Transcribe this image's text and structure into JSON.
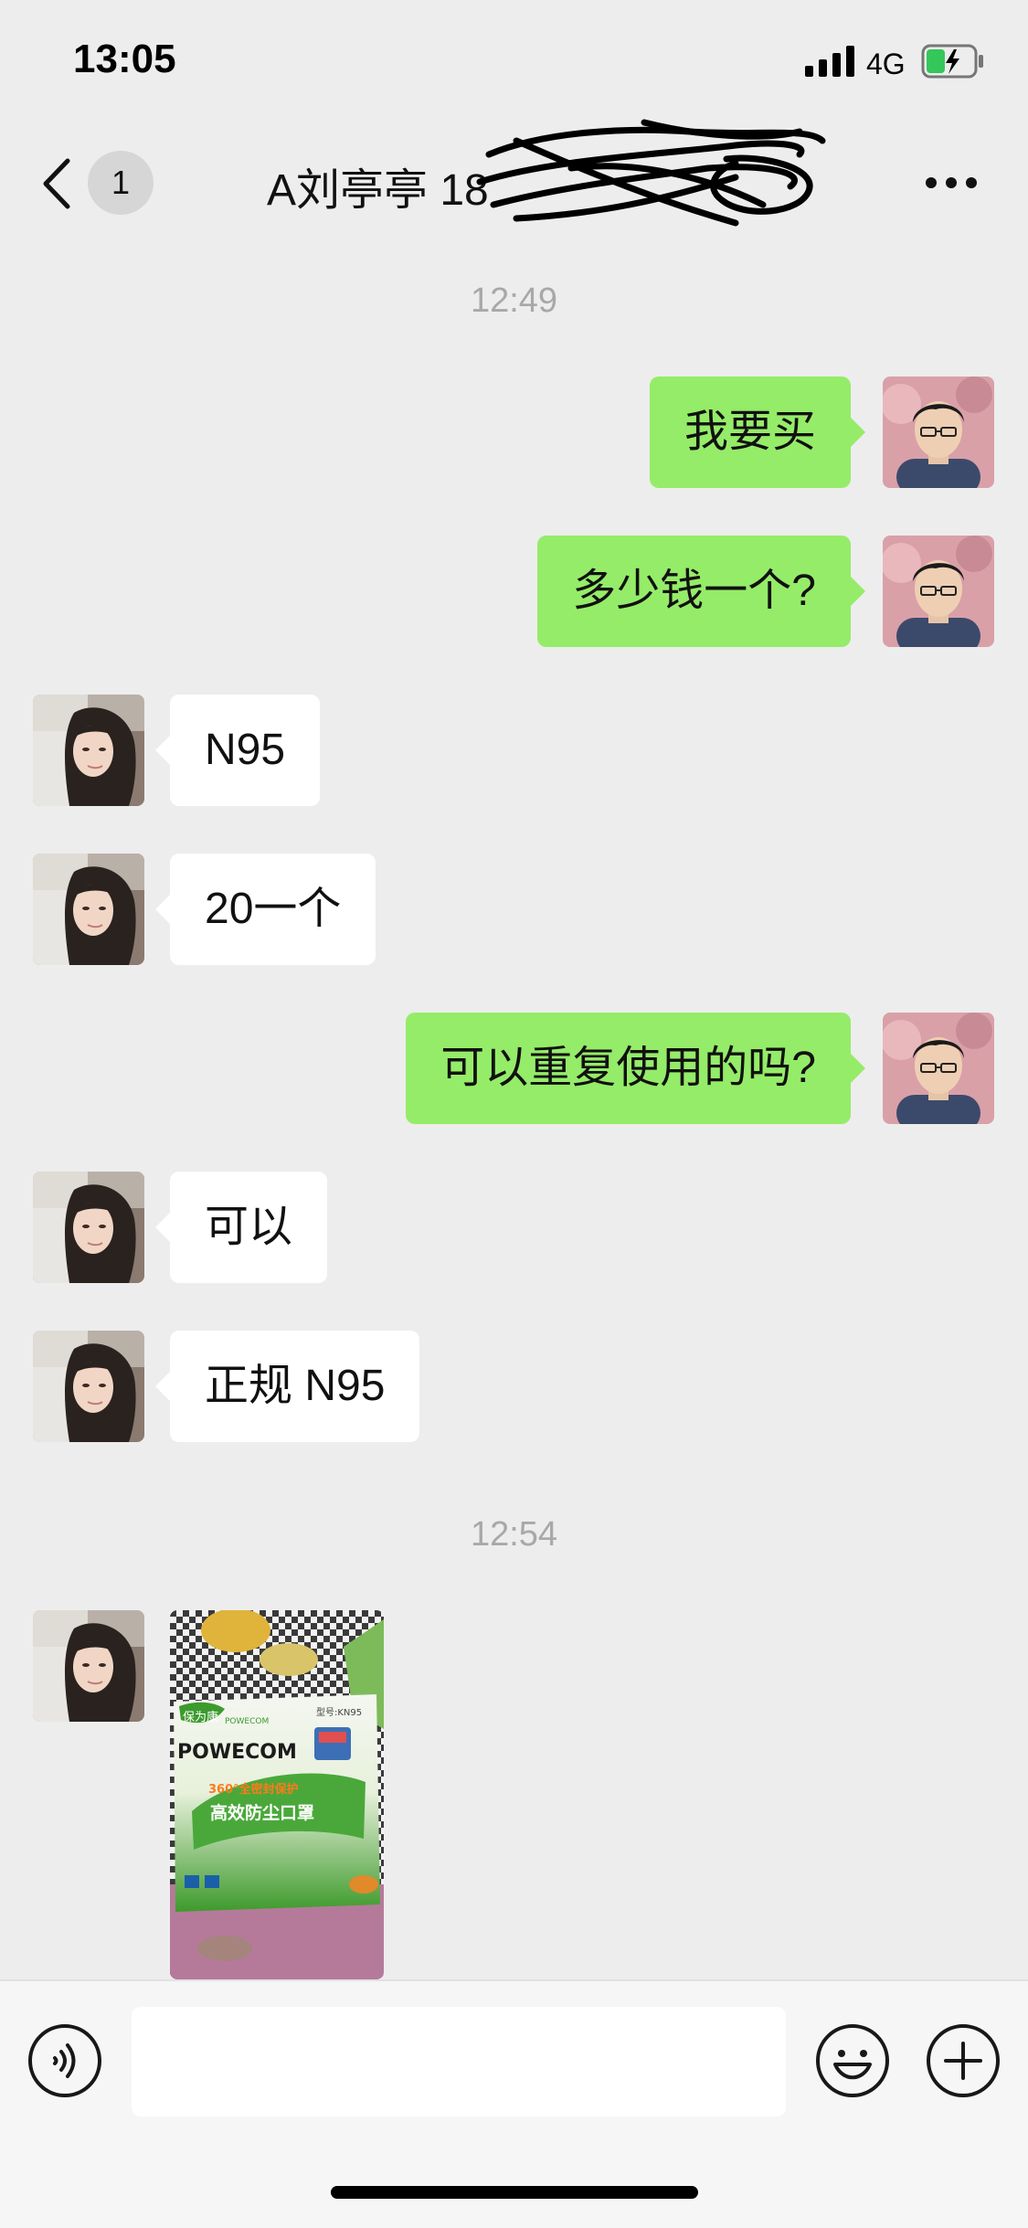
{
  "status_bar": {
    "time": "13:05",
    "network": "4G"
  },
  "header": {
    "back_label": "back",
    "unread_count": "1",
    "title": "A刘亭亭 18"
  },
  "messages": [
    {
      "type": "timestamp",
      "text": "12:49"
    },
    {
      "type": "text",
      "direction": "out",
      "text": "我要买"
    },
    {
      "type": "text",
      "direction": "out",
      "text": "多少钱一个?"
    },
    {
      "type": "text",
      "direction": "in",
      "text": "N95"
    },
    {
      "type": "text",
      "direction": "in",
      "text": "20一个"
    },
    {
      "type": "text",
      "direction": "out",
      "text": "可以重复使用的吗?"
    },
    {
      "type": "text",
      "direction": "in",
      "text": "可以"
    },
    {
      "type": "text",
      "direction": "in",
      "text": "正规 N95"
    },
    {
      "type": "timestamp",
      "text": "12:54"
    },
    {
      "type": "image",
      "direction": "in"
    }
  ],
  "photo": {
    "brand_cn": "保为康",
    "brand_en": "POWECOM",
    "brand_sub": "POWECOM",
    "model": "型号:KN95",
    "badge": "360°全密封保护",
    "product": "高效防尘口罩"
  },
  "colors": {
    "outgoing_bubble": "#95ec69",
    "incoming_bubble": "#ffffff",
    "background": "#ededed"
  },
  "input_bar": {
    "placeholder": "",
    "voice_icon": "voice-icon",
    "emoji_icon": "emoji-icon",
    "plus_icon": "plus-icon"
  }
}
